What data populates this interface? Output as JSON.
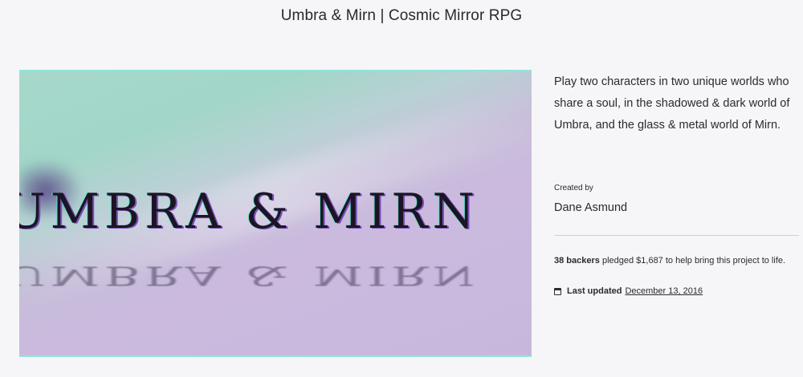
{
  "header": {
    "title": "Umbra & Mirn | Cosmic Mirror RPG"
  },
  "hero": {
    "logo_text": "UMBRA & MIRN",
    "colors": {
      "mint": "#a6d9cb",
      "lavender": "#cbbade",
      "border": "#8fe3d8"
    }
  },
  "project": {
    "description": "Play two characters in two unique worlds who share a soul, in the shadowed & dark world of Umbra, and the glass & metal world of Mirn.",
    "created_by_label": "Created by",
    "creator_name": "Dane Asmund",
    "backers": "38 backers",
    "pledge_text": "pledged $1,687 to help bring this project to life.",
    "last_updated_label": "Last updated",
    "last_updated_date": "December 13, 2016",
    "calendar_icon": "calendar-icon"
  }
}
